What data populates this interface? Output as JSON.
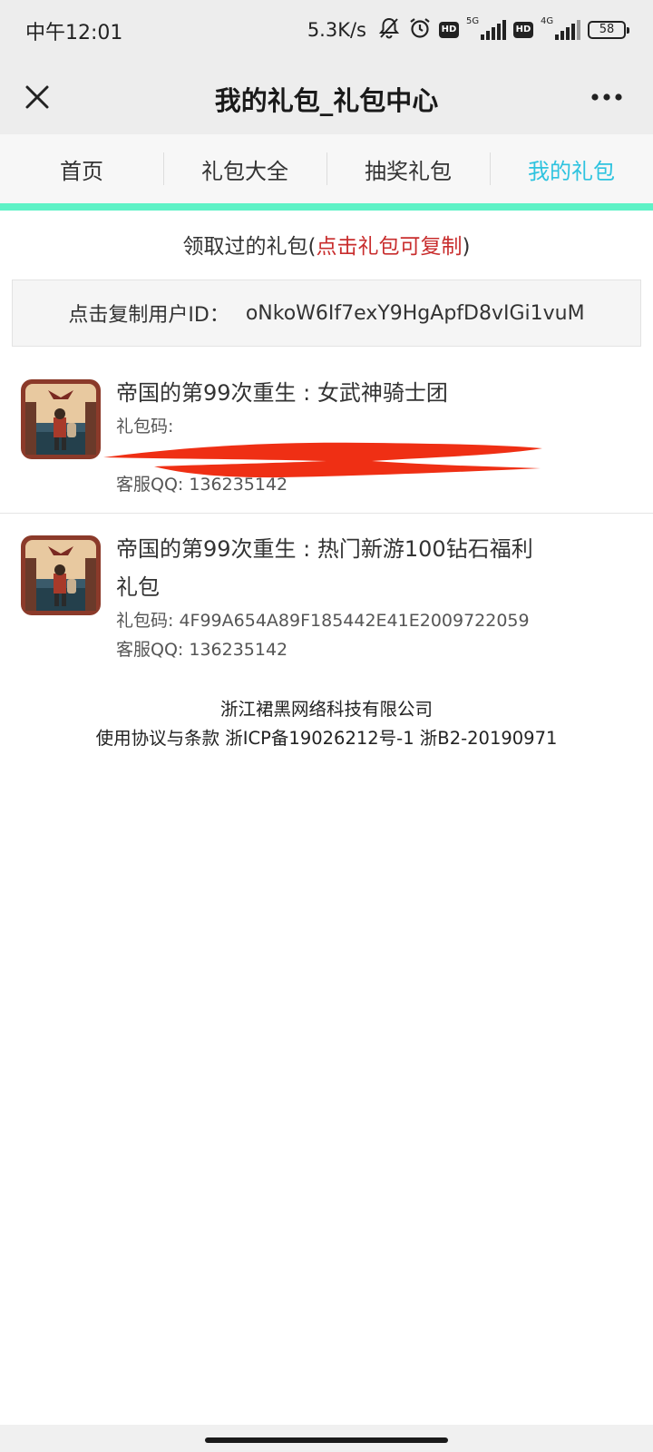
{
  "status_bar": {
    "time": "中午12:01",
    "speed": "5.3K/s",
    "icons": [
      "mute-bell-icon",
      "alarm-icon",
      "hd-icon",
      "signal-5g-icon",
      "hd-icon",
      "signal-4g-icon",
      "battery-icon"
    ],
    "hd_label": "HD",
    "network1": "5G",
    "network2": "4G",
    "battery": "58"
  },
  "header": {
    "title": "我的礼包_礼包中心"
  },
  "tabs": [
    {
      "label": "首页"
    },
    {
      "label": "礼包大全"
    },
    {
      "label": "抽奖礼包"
    },
    {
      "label": "我的礼包",
      "active": true
    }
  ],
  "notice": {
    "prefix": "领取过的礼包(",
    "highlight": "点击礼包可复制",
    "suffix": ")"
  },
  "user": {
    "label": "点击复制用户ID：",
    "id": "oNkoW6If7exY9HgApfD8vIGi1vuM"
  },
  "gifts": [
    {
      "name": "帝国的第99次重生 : 女武神骑士团",
      "code_label": "礼包码:",
      "code": "",
      "qq": "客服QQ: 136235142"
    },
    {
      "name": "帝国的第99次重生 : 热门新游100钻石福利礼包",
      "code_label": "礼包码: ",
      "code": "4F99A654A89F185442E41E2009722059",
      "qq": "客服QQ: 136235142"
    }
  ],
  "footer": {
    "company": "浙江裙黑网络科技有限公司",
    "links": "使用协议与条款 浙ICP备19026212号-1 浙B2-20190971"
  },
  "colors": {
    "active_tab": "#2ec3df",
    "tab_underline": "#5ef2c6",
    "highlight": "#c82d2d",
    "redaction": "#ef2f14"
  }
}
